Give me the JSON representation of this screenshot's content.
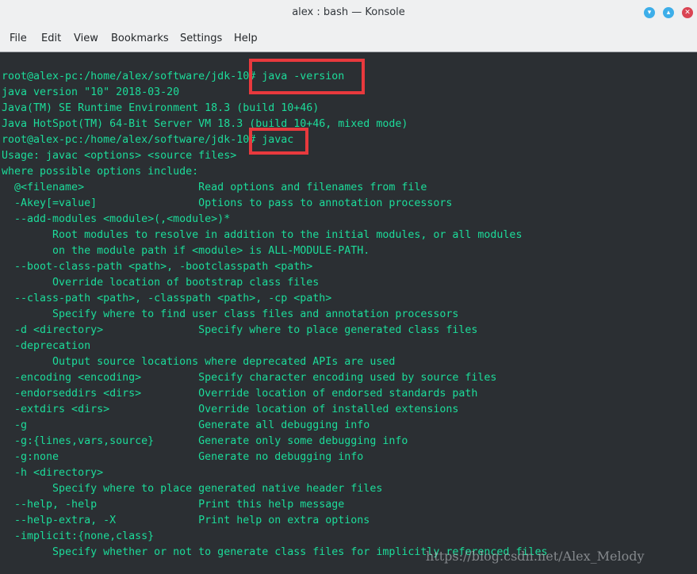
{
  "window": {
    "title": "alex : bash — Konsole",
    "buttons": {
      "minimize": "▾",
      "maximize": "▴",
      "close": "✕"
    }
  },
  "menu": [
    "File",
    "Edit",
    "View",
    "Bookmarks",
    "Settings",
    "Help"
  ],
  "terminal": {
    "text_color": "#1cdc9a",
    "background": "#2b2f33",
    "lines": [
      "root@alex-pc:/home/alex/software/jdk-10# java -version",
      "java version \"10\" 2018-03-20",
      "Java(TM) SE Runtime Environment 18.3 (build 10+46)",
      "Java HotSpot(TM) 64-Bit Server VM 18.3 (build 10+46, mixed mode)",
      "root@alex-pc:/home/alex/software/jdk-10# javac",
      "Usage: javac <options> <source files>",
      "where possible options include:",
      "  @<filename>                  Read options and filenames from file",
      "  -Akey[=value]                Options to pass to annotation processors",
      "  --add-modules <module>(,<module>)*",
      "        Root modules to resolve in addition to the initial modules, or all modules",
      "        on the module path if <module> is ALL-MODULE-PATH.",
      "  --boot-class-path <path>, -bootclasspath <path>",
      "        Override location of bootstrap class files",
      "  --class-path <path>, -classpath <path>, -cp <path>",
      "        Specify where to find user class files and annotation processors",
      "  -d <directory>               Specify where to place generated class files",
      "  -deprecation",
      "        Output source locations where deprecated APIs are used",
      "  -encoding <encoding>         Specify character encoding used by source files",
      "  -endorseddirs <dirs>         Override location of endorsed standards path",
      "  -extdirs <dirs>              Override location of installed extensions",
      "  -g                           Generate all debugging info",
      "  -g:{lines,vars,source}       Generate only some debugging info",
      "  -g:none                      Generate no debugging info",
      "  -h <directory>",
      "        Specify where to place generated native header files",
      "  --help, -help                Print this help message",
      "  --help-extra, -X             Print help on extra options",
      "  -implicit:{none,class}",
      "        Specify whether or not to generate class files for implicitly referenced files"
    ]
  },
  "annotation_color": "#e8393d",
  "watermark": "https://blog.csdn.net/Alex_Melody"
}
